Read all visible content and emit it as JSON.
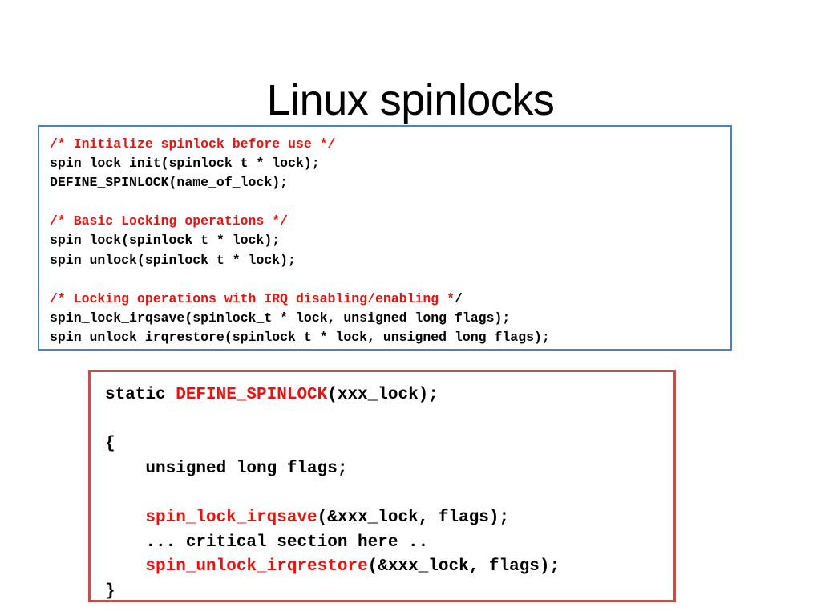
{
  "slide": {
    "title": "Linux spinlocks"
  },
  "colors": {
    "comment_red": "#e8130f",
    "code_black": "#000000",
    "api_box_border": "#4f81bd",
    "usage_box_border": "#c0504d",
    "background": "#ffffff"
  },
  "api_box": {
    "name": "spinlock-api-reference",
    "lines": [
      [
        {
          "text": "/* Initialize spinlock before use */",
          "color": "red"
        }
      ],
      [
        {
          "text": "spin_lock_init(spinlock_t * lock);",
          "color": "black"
        }
      ],
      [
        {
          "text": "DEFINE_SPINLOCK(name_of_lock);",
          "color": "black"
        }
      ],
      [],
      [
        {
          "text": "/* Basic Locking operations */",
          "color": "red"
        }
      ],
      [
        {
          "text": "spin_lock(spinlock_t * lock);",
          "color": "black"
        }
      ],
      [
        {
          "text": "spin_unlock(spinlock_t * lock);",
          "color": "black"
        }
      ],
      [],
      [
        {
          "text": "/* Locking operations with IRQ disabling/enabling *",
          "color": "red"
        },
        {
          "text": "/",
          "color": "black"
        }
      ],
      [
        {
          "text": "spin_lock_irqsave(spinlock_t * lock, unsigned long flags);",
          "color": "black"
        }
      ],
      [
        {
          "text": "spin_unlock_irqrestore(spinlock_t * lock, unsigned long flags);",
          "color": "black"
        }
      ]
    ]
  },
  "usage_box": {
    "name": "spinlock-usage-example",
    "lines": [
      [
        {
          "text": "static ",
          "color": "black"
        },
        {
          "text": "DEFINE_SPINLOCK",
          "color": "red"
        },
        {
          "text": "(xxx_lock);",
          "color": "black"
        }
      ],
      [],
      [
        {
          "text": "{",
          "color": "black"
        }
      ],
      [
        {
          "text": "    unsigned long flags;",
          "color": "black"
        }
      ],
      [],
      [
        {
          "text": "    ",
          "color": "black"
        },
        {
          "text": "spin_lock_irqsave",
          "color": "red"
        },
        {
          "text": "(&xxx_lock, flags);",
          "color": "black"
        }
      ],
      [
        {
          "text": "    ... critical section here ..",
          "color": "black"
        }
      ],
      [
        {
          "text": "    ",
          "color": "black"
        },
        {
          "text": "spin_unlock_irqrestore",
          "color": "red"
        },
        {
          "text": "(&xxx_lock, flags);",
          "color": "black"
        }
      ],
      [
        {
          "text": "}",
          "color": "black"
        }
      ]
    ]
  }
}
